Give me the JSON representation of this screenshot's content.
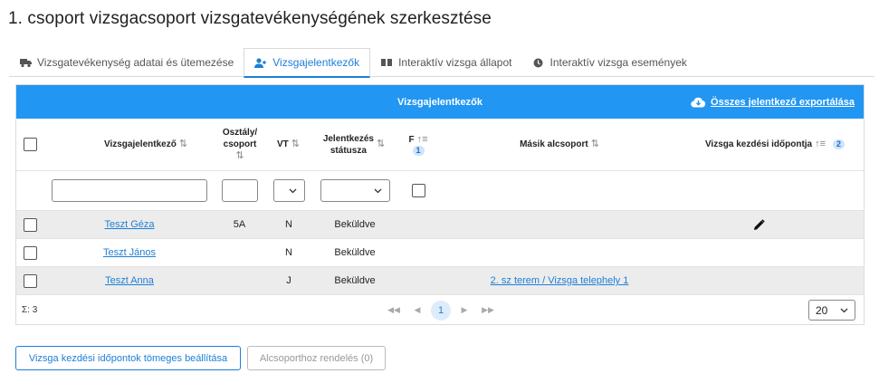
{
  "page": {
    "title": "1. csoport vizsgacsoport vizsgatevékenységének szerkesztése"
  },
  "tabs": [
    {
      "label": "Vizsgatevékenység adatai és ütemezése",
      "icon": "truck-icon",
      "active": false
    },
    {
      "label": "Vizsgajelentkezők",
      "icon": "user-plus-icon",
      "active": true
    },
    {
      "label": "Interaktív vizsga állapot",
      "icon": "book-open-icon",
      "active": false
    },
    {
      "label": "Interaktív vizsga események",
      "icon": "clock-icon",
      "active": false
    }
  ],
  "panel": {
    "title": "Vizsgajelentkezők",
    "export_label": "Összes jelentkező exportálása"
  },
  "columns": {
    "name": "Vizsgajelentkező",
    "class_line1": "Osztály/",
    "class_line2": "csoport",
    "vt": "VT",
    "status_line1": "Jelentkezés",
    "status_line2": "státusza",
    "f": "F",
    "f_badge": "1",
    "subgroup": "Másik alcsoport",
    "start": "Vizsga kezdési időpontja",
    "start_badge": "2"
  },
  "rows": [
    {
      "name": "Teszt Géza",
      "class": "5A",
      "vt": "N",
      "status": "Beküldve",
      "subgroup": "",
      "editable": true
    },
    {
      "name": "Teszt János",
      "class": "",
      "vt": "N",
      "status": "Beküldve",
      "subgroup": "",
      "editable": false
    },
    {
      "name": "Teszt Anna",
      "class": "",
      "vt": "J",
      "status": "Beküldve",
      "subgroup": "2. sz terem / Vizsga telephely 1",
      "editable": false
    }
  ],
  "footer": {
    "sum": "Σ: 3",
    "current_page": "1",
    "page_size": "20"
  },
  "buttons": {
    "bulk_label": "Vizsga kezdési időpontok tömeges beállítása",
    "assign_label": "Alcsoporthoz rendelés (0)"
  },
  "colors": {
    "accent": "#2196f3",
    "link": "#1d7fd6",
    "row_alt": "#ececec"
  }
}
